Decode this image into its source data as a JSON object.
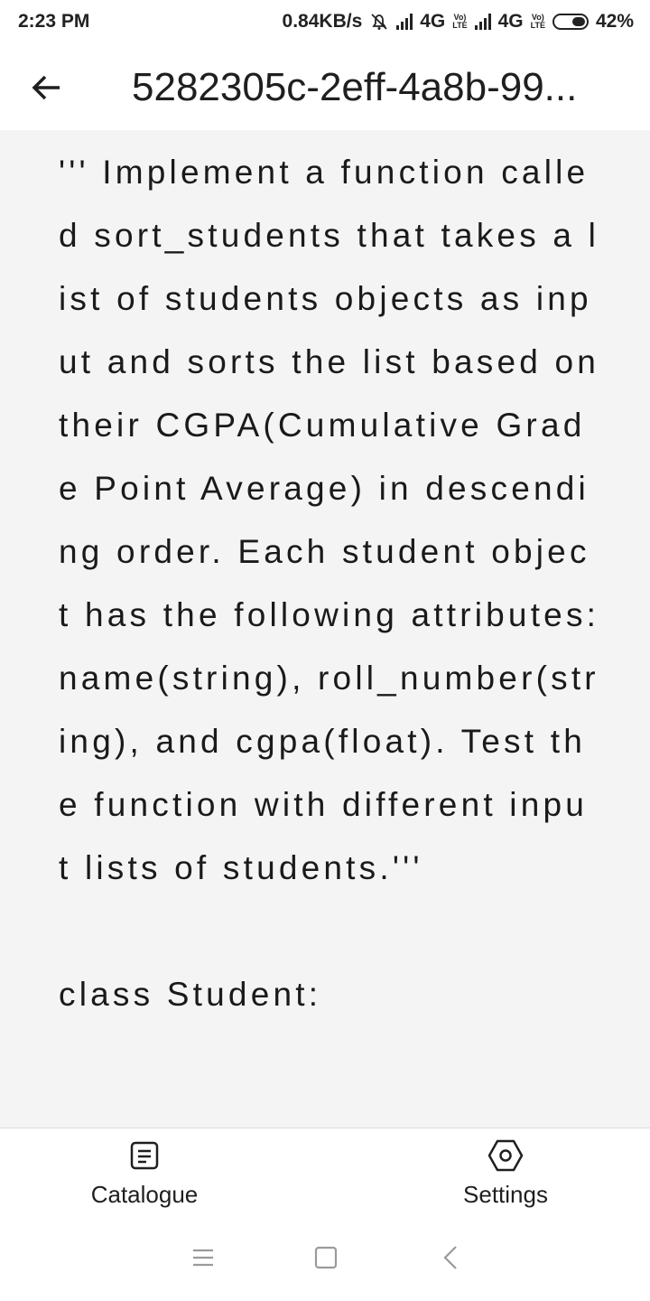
{
  "status_bar": {
    "time": "2:23 PM",
    "network_speed": "0.84KB/s",
    "network_type_1": "4G",
    "network_type_2": "4G",
    "volte_label": "Vo)\nLTE",
    "battery_percent": "42%",
    "battery_level": 0.42
  },
  "app_bar": {
    "title": "5282305c-2eff-4a8b-99..."
  },
  "content": {
    "text": "''' Implement a function called sort_students that takes a list of students objects as input and sorts the list based on their CGPA(Cumulative Grade Point Average) in descending order. Each student object has the following attributes: name(string), roll_number(string), and cgpa(float). Test the function with different input lists of students.'''\n\nclass Student:"
  },
  "bottom_nav": {
    "items": [
      {
        "label": "Catalogue",
        "icon": "document-icon"
      },
      {
        "label": "Settings",
        "icon": "hexagon-gear-icon"
      }
    ]
  },
  "system_nav": {
    "icons": [
      "menu-icon",
      "home-square-icon",
      "back-chevron-icon"
    ]
  }
}
